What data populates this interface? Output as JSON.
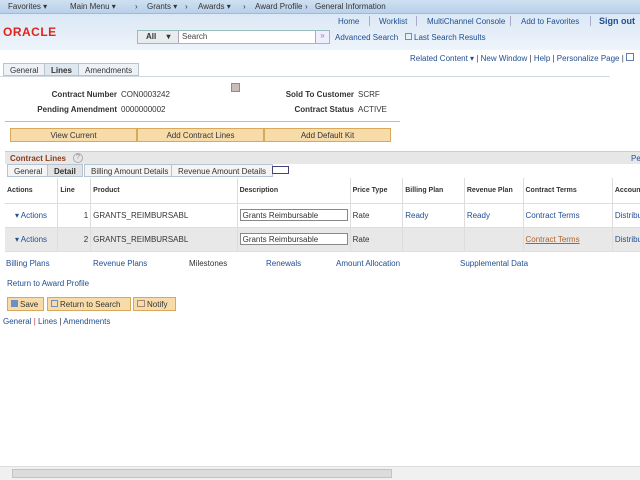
{
  "topnav": {
    "favorites": "Favorites ▾",
    "main_menu": "Main Menu ▾",
    "breadcrumbs": [
      "Grants ▾",
      "Awards ▾",
      "Award Profile",
      "General Information"
    ]
  },
  "header": {
    "logo": "ORACLE",
    "links": [
      "Home",
      "Worklist",
      "MultiChannel Console",
      "Add to Favorites",
      "Sign out"
    ],
    "search_scope": "All",
    "search_placeholder": "Search",
    "advanced_search": "Advanced Search",
    "last_search": "Last Search Results"
  },
  "pagebar": {
    "related": "Related Content ▾",
    "new_window": "New Window",
    "help": "Help",
    "personalize": "Personalize Page"
  },
  "tabs": [
    "General",
    "Lines",
    "Amendments"
  ],
  "contract": {
    "number_label": "Contract Number",
    "number": "CON0003242",
    "pending_label": "Pending Amendment",
    "pending": "0000000002",
    "customer_label": "Sold To Customer",
    "customer": "SCRF",
    "status_label": "Contract Status",
    "status": "ACTIVE"
  },
  "buttons": [
    "View Current",
    "Add Contract Lines",
    "Add Default Kit"
  ],
  "lines": {
    "title": "Contract Lines",
    "pe": "Pe",
    "subtabs": [
      "General",
      "Detail",
      "Billing Amount Details",
      "Revenue Amount Details"
    ],
    "columns": [
      "Actions",
      "Line",
      "Product",
      "Description",
      "Price Type",
      "Billing Plan",
      "Revenue Plan",
      "Contract Terms",
      "Accoun"
    ],
    "rows": [
      {
        "actions": "▾ Actions",
        "line": "1",
        "product": "GRANTS_REIMBURSABL",
        "description": "Grants Reimbursable",
        "price_type": "Rate",
        "billing_plan": "Ready",
        "revenue_plan": "Ready",
        "terms": "Contract Terms",
        "account": "Distribu"
      },
      {
        "actions": "▾ Actions",
        "line": "2",
        "product": "GRANTS_REIMBURSABL",
        "description": "Grants Reimbursable",
        "price_type": "Rate",
        "billing_plan": "",
        "revenue_plan": "",
        "terms": "Contract Terms",
        "account": "Distribu"
      }
    ]
  },
  "links": [
    "Billing Plans",
    "Revenue Plans",
    "Milestones",
    "Renewals",
    "Amount Allocation",
    "Supplemental Data"
  ],
  "return_link": "Return to Award Profile",
  "actions": {
    "save": "Save",
    "return_search": "Return to Search",
    "notify": "Notify"
  },
  "footer_links": [
    "General",
    "Lines",
    "Amendments"
  ]
}
